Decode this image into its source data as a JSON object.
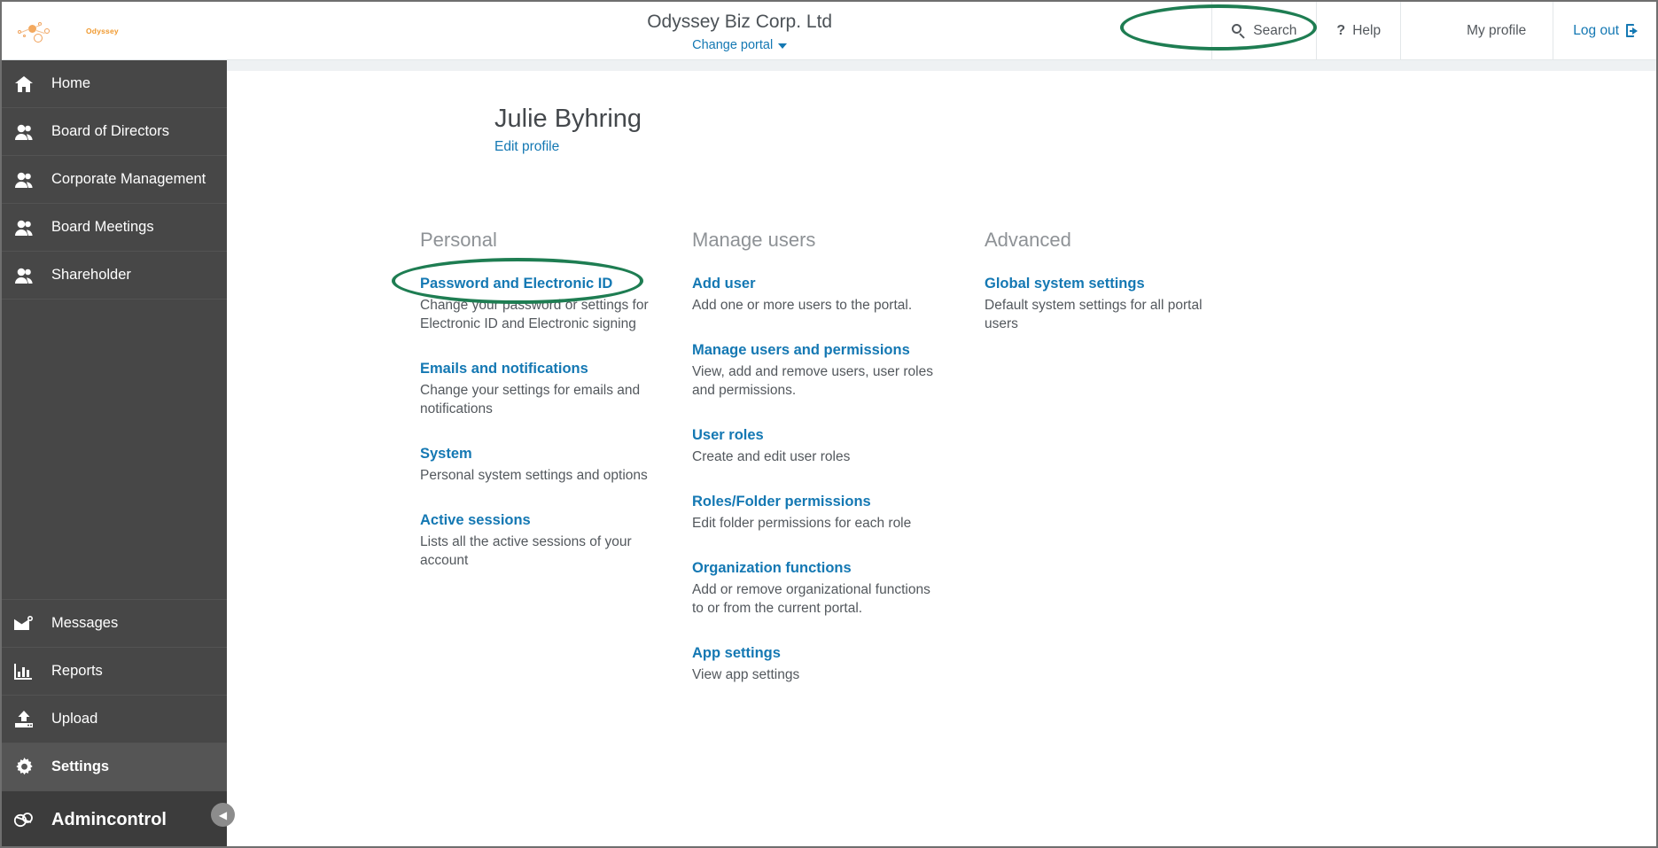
{
  "brand": {
    "name": "Odyssey",
    "logo_icon": "molecule-network-icon"
  },
  "header": {
    "portal_title": "Odyssey Biz Corp. Ltd",
    "change_portal": "Change portal",
    "change_portal_icon": "caret-down-icon",
    "nav": [
      {
        "label": "Search",
        "icon": "search-icon"
      },
      {
        "label": "Help",
        "icon": "question-mark-icon"
      },
      {
        "label": "My profile",
        "icon": "avatar-icon"
      },
      {
        "label": "Log out",
        "icon": "logout-arrow-icon"
      }
    ]
  },
  "sidebar": {
    "items": [
      {
        "label": "Home",
        "icon": "house-icon"
      },
      {
        "label": "Board of Directors",
        "icon": "users-icon"
      },
      {
        "label": "Corporate Management",
        "icon": "users-icon"
      },
      {
        "label": "Board Meetings",
        "icon": "users-icon"
      },
      {
        "label": "Shareholder",
        "icon": "users-icon"
      }
    ],
    "bottom_items": [
      {
        "label": "Messages",
        "icon": "envelope-icon"
      },
      {
        "label": "Reports",
        "icon": "bar-chart-icon"
      },
      {
        "label": "Upload",
        "icon": "upload-arrow-icon"
      },
      {
        "label": "Settings",
        "icon": "gear-icon"
      }
    ],
    "admin": {
      "label": "Admincontrol",
      "icon": "admincontrol-logo-icon"
    },
    "collapse_icon": "chevron-left-icon"
  },
  "profile": {
    "name": "Julie Byhring",
    "edit_link": "Edit profile",
    "avatar_icon": "user-photo-avatar"
  },
  "columns": [
    {
      "title": "Personal",
      "entries": [
        {
          "link": "Password and Electronic ID",
          "desc": "Change your password or settings for Electronic ID and Electronic signing"
        },
        {
          "link": "Emails and notifications",
          "desc": "Change your settings for emails and notifications"
        },
        {
          "link": "System",
          "desc": "Personal system settings and options"
        },
        {
          "link": "Active sessions",
          "desc": "Lists all the active sessions of your account"
        }
      ]
    },
    {
      "title": "Manage users",
      "entries": [
        {
          "link": "Add user",
          "desc": "Add one or more users to the portal."
        },
        {
          "link": "Manage users and permissions",
          "desc": "View, add and remove users, user roles and permissions."
        },
        {
          "link": "User roles",
          "desc": "Create and edit user roles"
        },
        {
          "link": "Roles/Folder permissions",
          "desc": "Edit folder permissions for each role"
        },
        {
          "link": "Organization functions",
          "desc": "Add or remove organizational functions to or from the current portal."
        },
        {
          "link": "App settings",
          "desc": "View app settings"
        }
      ]
    },
    {
      "title": "Advanced",
      "entries": [
        {
          "link": "Global system settings",
          "desc": "Default system settings for all portal users"
        }
      ]
    }
  ],
  "annotations": {
    "accent_highlight_color": "#1e7d52",
    "link_color": "#1478b3",
    "sidebar_bg": "#474747"
  }
}
